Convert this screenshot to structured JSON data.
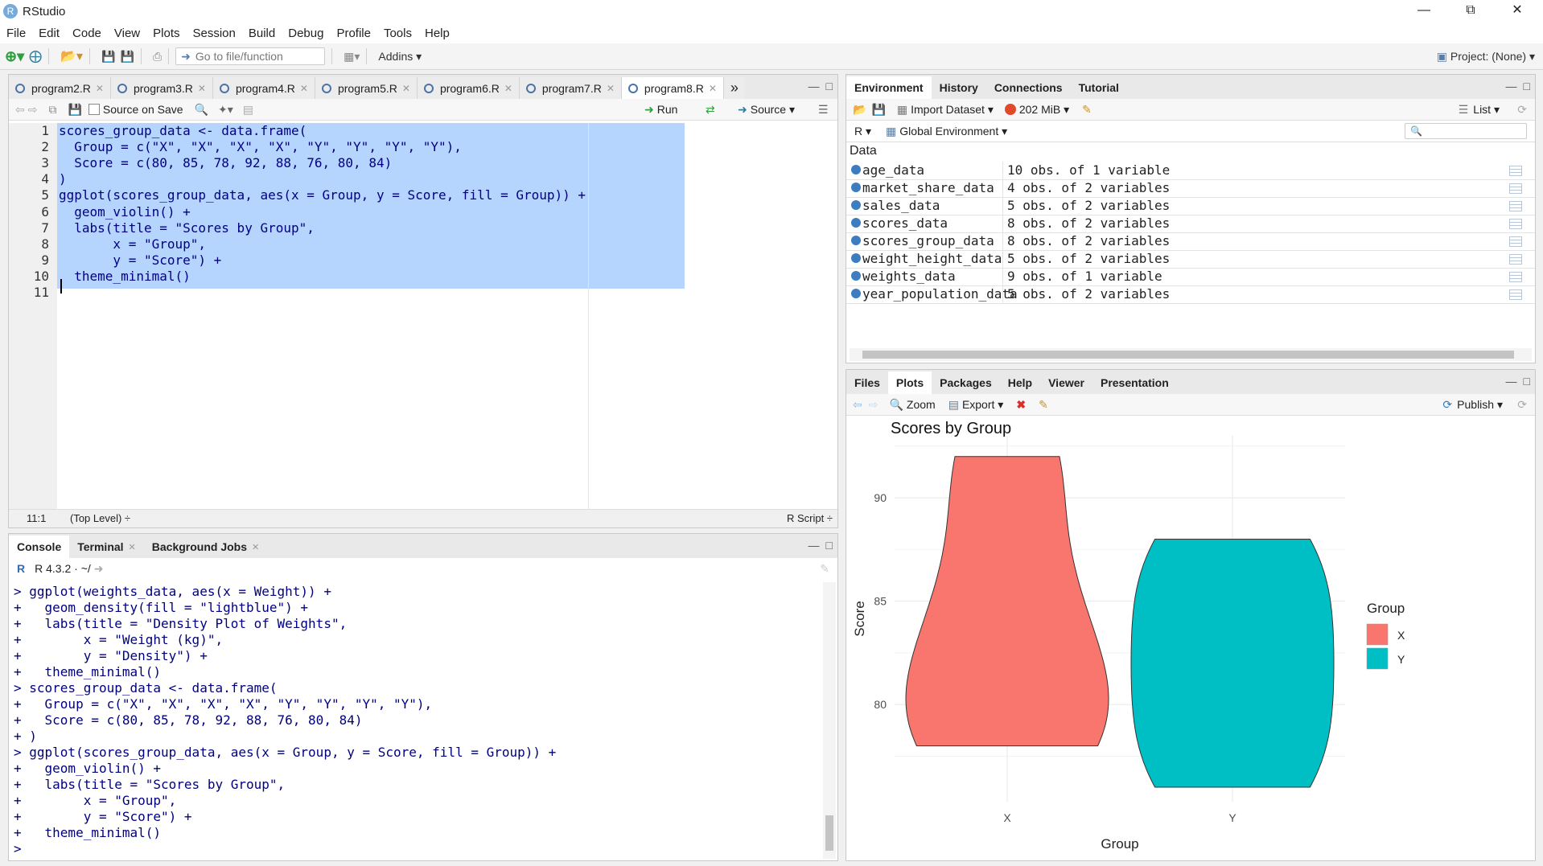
{
  "window": {
    "title": "RStudio",
    "app_icon": "R"
  },
  "menu": [
    "File",
    "Edit",
    "Code",
    "View",
    "Plots",
    "Session",
    "Build",
    "Debug",
    "Profile",
    "Tools",
    "Help"
  ],
  "toolbar": {
    "goto_placeholder": "Go to file/function",
    "addins": "Addins",
    "project": "Project: (None)"
  },
  "editor": {
    "tabs": [
      "program2.R",
      "program3.R",
      "program4.R",
      "program5.R",
      "program6.R",
      "program7.R",
      "program8.R"
    ],
    "active_tab": "program8.R",
    "source_on_save": "Source on Save",
    "run": "Run",
    "source": "Source",
    "lines": [
      "scores_group_data <- data.frame(",
      "  Group = c(\"X\", \"X\", \"X\", \"X\", \"Y\", \"Y\", \"Y\", \"Y\"),",
      "  Score = c(80, 85, 78, 92, 88, 76, 80, 84)",
      ")",
      "ggplot(scores_group_data, aes(x = Group, y = Score, fill = Group)) +",
      "  geom_violin() +",
      "  labs(title = \"Scores by Group\",",
      "       x = \"Group\",",
      "       y = \"Score\") +",
      "  theme_minimal()",
      ""
    ],
    "line_numbers": [
      "1",
      "2",
      "3",
      "4",
      "5",
      "6",
      "7",
      "8",
      "9",
      "10",
      "11"
    ],
    "status_pos": "11:1",
    "status_level": "(Top Level) ÷",
    "status_type": "R Script ÷"
  },
  "console": {
    "tabs": [
      "Console",
      "Terminal",
      "Background Jobs"
    ],
    "r_version": "R 4.3.2 · ~/",
    "lines": [
      "> ggplot(weights_data, aes(x = Weight)) +",
      "+   geom_density(fill = \"lightblue\") +",
      "+   labs(title = \"Density Plot of Weights\",",
      "+        x = \"Weight (kg)\",",
      "+        y = \"Density\") +",
      "+   theme_minimal()",
      "> scores_group_data <- data.frame(",
      "+   Group = c(\"X\", \"X\", \"X\", \"X\", \"Y\", \"Y\", \"Y\", \"Y\"),",
      "+   Score = c(80, 85, 78, 92, 88, 76, 80, 84)",
      "+ )",
      "> ggplot(scores_group_data, aes(x = Group, y = Score, fill = Group)) +",
      "+   geom_violin() +",
      "+   labs(title = \"Scores by Group\",",
      "+        x = \"Group\",",
      "+        y = \"Score\") +",
      "+   theme_minimal()",
      "> "
    ]
  },
  "environment": {
    "tabs": [
      "Environment",
      "History",
      "Connections",
      "Tutorial"
    ],
    "import_dataset": "Import Dataset",
    "memory": "202 MiB",
    "view_mode": "List",
    "lang": "R",
    "scope": "Global Environment",
    "section": "Data",
    "rows": [
      {
        "name": "age_data",
        "value": "10 obs. of 1 variable"
      },
      {
        "name": "market_share_data",
        "value": "4 obs. of 2 variables"
      },
      {
        "name": "sales_data",
        "value": "5 obs. of 2 variables"
      },
      {
        "name": "scores_data",
        "value": "8 obs. of 2 variables"
      },
      {
        "name": "scores_group_data",
        "value": "8 obs. of 2 variables"
      },
      {
        "name": "weight_height_data",
        "value": "5 obs. of 2 variables"
      },
      {
        "name": "weights_data",
        "value": "9 obs. of 1 variable"
      },
      {
        "name": "year_population_data",
        "value": "5 obs. of 2 variables"
      }
    ]
  },
  "files": {
    "tabs": [
      "Files",
      "Plots",
      "Packages",
      "Help",
      "Viewer",
      "Presentation"
    ],
    "active_tab": "Plots",
    "zoom": "Zoom",
    "export": "Export",
    "publish": "Publish"
  },
  "chart_data": {
    "type": "violin",
    "title": "Scores by Group",
    "xlabel": "Group",
    "ylabel": "Score",
    "categories": [
      "X",
      "Y"
    ],
    "groups": [
      {
        "name": "X",
        "values": [
          80,
          85,
          78,
          92
        ],
        "color": "#f8766d"
      },
      {
        "name": "Y",
        "values": [
          88,
          76,
          80,
          84
        ],
        "color": "#00bfc4"
      }
    ],
    "ylim": [
      75.3,
      93
    ],
    "yticks": [
      "80",
      "85",
      "90"
    ],
    "legend": {
      "title": "Group",
      "position": "right",
      "entries": [
        "X",
        "Y"
      ]
    },
    "grid": true
  }
}
